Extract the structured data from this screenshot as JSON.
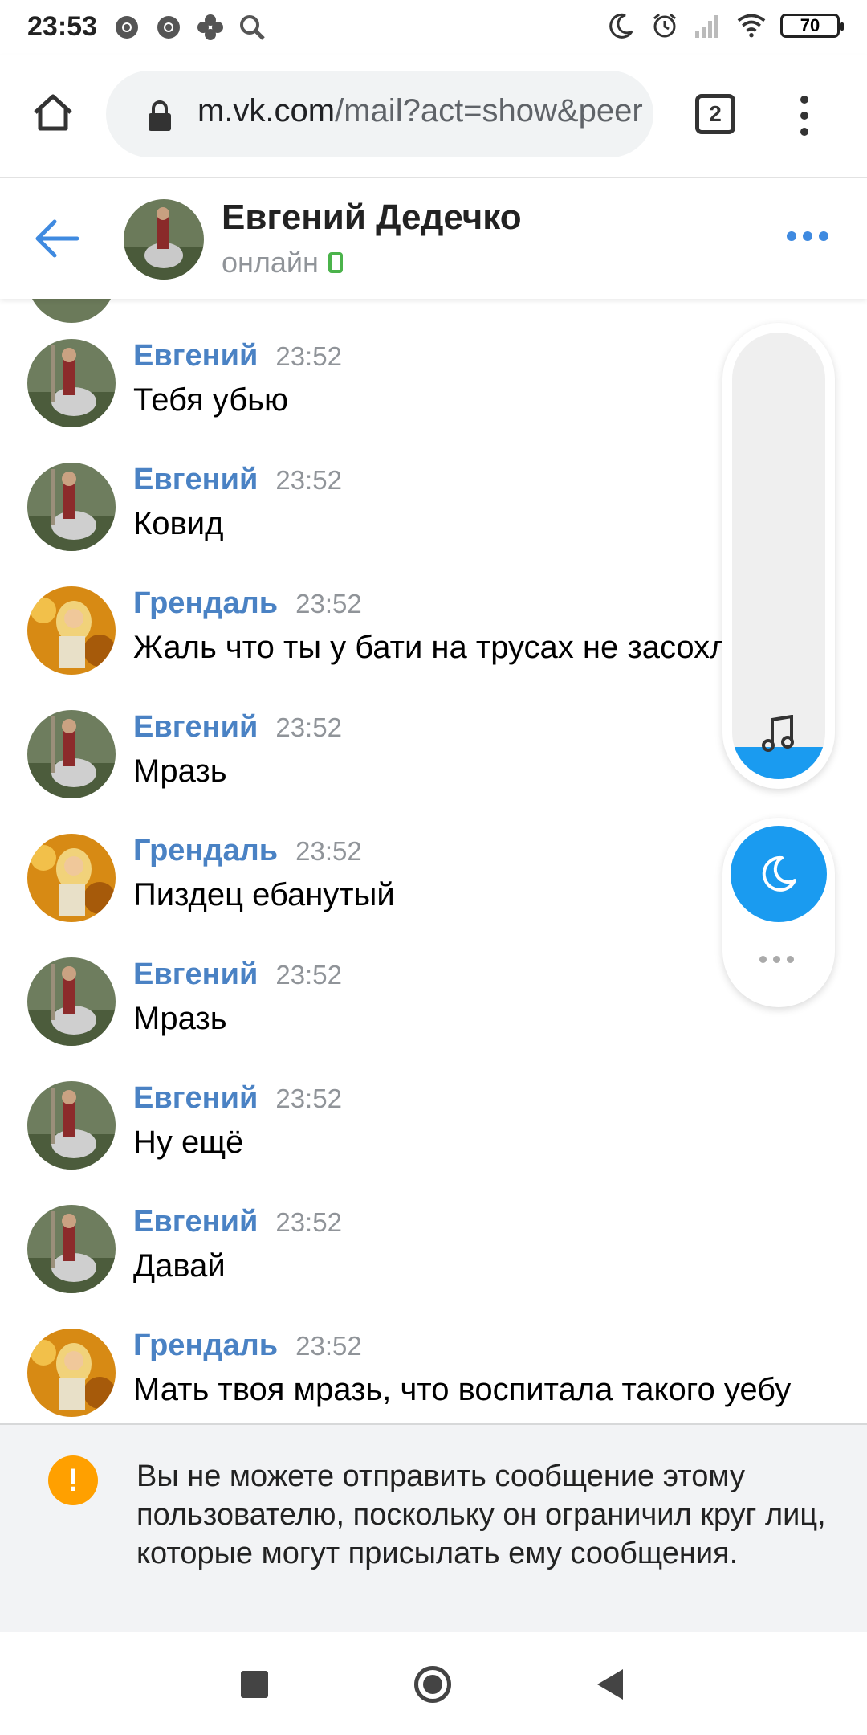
{
  "status_bar": {
    "time": "23:53",
    "battery": "70",
    "left_icons": [
      "chrome-icon",
      "chrome-icon",
      "fan-icon",
      "search-icon"
    ],
    "right_icons": [
      "moon-icon",
      "alarm-icon",
      "signal-icon",
      "wifi-icon"
    ]
  },
  "browser": {
    "url_host": "m.vk.com",
    "url_rest": "/mail?act=show&peer",
    "tab_count": "2"
  },
  "chat_header": {
    "name": "Евгений Дедечко",
    "status": "онлайн"
  },
  "messages": [
    {
      "sender": "Евгений",
      "time": "23:52",
      "text": "Тебя убью",
      "avatar": "evgeny"
    },
    {
      "sender": "Евгений",
      "time": "23:52",
      "text": "Ковид",
      "avatar": "evgeny"
    },
    {
      "sender": "Грендаль",
      "time": "23:52",
      "text": "Жаль что ты у бати на трусах не засохла",
      "avatar": "grendal"
    },
    {
      "sender": "Евгений",
      "time": "23:52",
      "text": "Мразь",
      "avatar": "evgeny"
    },
    {
      "sender": "Грендаль",
      "time": "23:52",
      "text": "Пиздец ебанутый",
      "avatar": "grendal"
    },
    {
      "sender": "Евгений",
      "time": "23:52",
      "text": "Мразь",
      "avatar": "evgeny"
    },
    {
      "sender": "Евгений",
      "time": "23:52",
      "text": "Ну ещё",
      "avatar": "evgeny"
    },
    {
      "sender": "Евгений",
      "time": "23:52",
      "text": "Давай",
      "avatar": "evgeny"
    },
    {
      "sender": "Грендаль",
      "time": "23:52",
      "text": "Мать твоя мразь, что воспитала такого уебу",
      "avatar": "grendal"
    }
  ],
  "notice": {
    "icon": "warning-icon",
    "text": "Вы не можете отправить сообщение этому пользователю, поскольку он ограничил круг лиц, которые могут присылать ему сообщения."
  },
  "colors": {
    "accent": "#3f8ae0",
    "sender_name": "#4a82c4",
    "online": "#4bb34b",
    "widget_blue": "#1a9bf0",
    "warning": "#ffa000"
  }
}
